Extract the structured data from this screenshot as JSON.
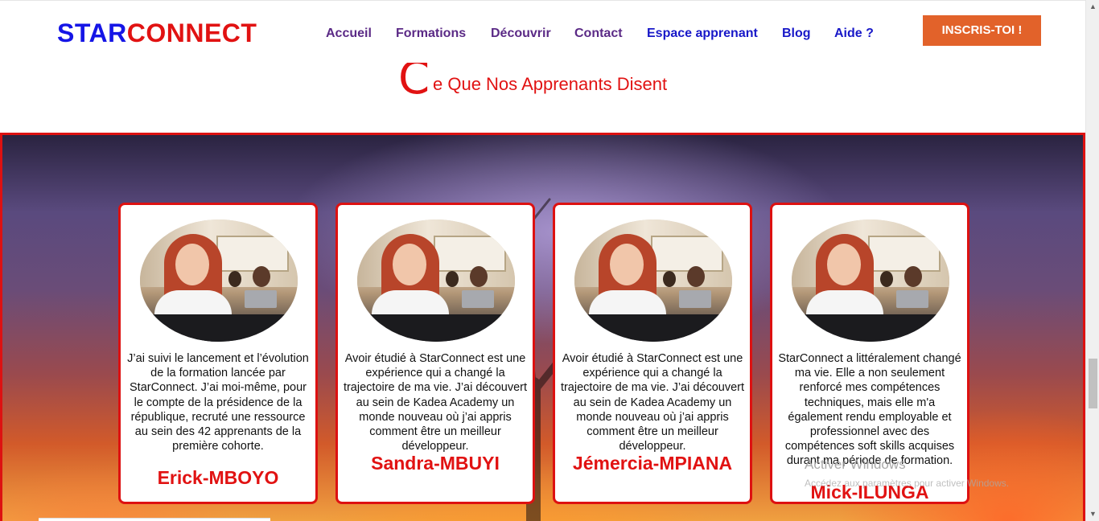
{
  "header": {
    "logo_part1": "STAR",
    "logo_part2": "CONNECT",
    "nav": [
      {
        "label": "Accueil"
      },
      {
        "label": "Formations"
      },
      {
        "label": "Découvrir"
      },
      {
        "label": "Contact"
      },
      {
        "label": "Espace apprenant"
      },
      {
        "label": "Blog"
      },
      {
        "label": "Aide ?"
      }
    ],
    "cta_label": "INSCRIS-TOI !"
  },
  "section": {
    "title_initial": "C",
    "title_rest": "e Que Nos Apprenants Disent"
  },
  "testimonials": [
    {
      "quote": "J’ai suivi le lancement et l’évolution de la formation lancée par StarConnect. J’ai moi-même, pour le compte de la présidence de la république, recruté une ressource au sein des 42 apprenants de la première cohorte.",
      "name": "Erick-MBOYO"
    },
    {
      "quote": "Avoir étudié à StarConnect est une expérience qui a changé la trajectoire de ma vie. J’ai découvert au sein de Kadea Academy un monde nouveau où j’ai appris comment être un meilleur développeur.",
      "name": "Sandra-MBUYI"
    },
    {
      "quote": "Avoir étudié à StarConnect est une expérience qui a changé la trajectoire de ma vie. J’ai découvert au sein de Kadea Academy un monde nouveau où j’ai appris comment être un meilleur développeur.",
      "name": "Jémercia-MPIANA"
    },
    {
      "quote": "StarConnect a littéralement changé ma vie. Elle a non seulement renforcé mes compétences techniques, mais elle m'a également rendu employable et professionnel avec des compétences soft skills acquises durant ma période de formation.",
      "name": "Mick-ILUNGA"
    }
  ],
  "overlay": {
    "watermark_title": "Activer Windows",
    "watermark_sub": "Accédez aux paramètres pour activer Windows."
  },
  "colors": {
    "brand_blue": "#1515e6",
    "brand_red": "#e11212",
    "nav_purple": "#5b2a86",
    "nav_blue": "#1818c8",
    "cta_orange": "#e2622a"
  }
}
